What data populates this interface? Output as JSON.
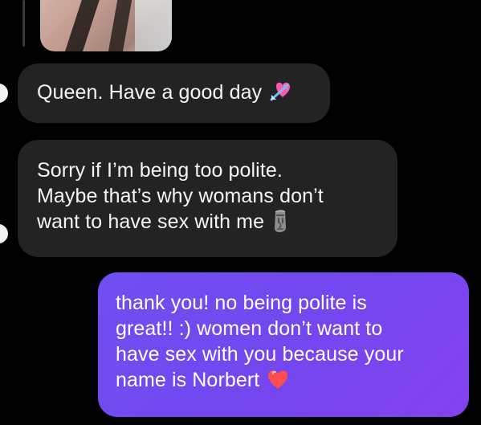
{
  "messages": [
    {
      "side": "incoming",
      "lines": [
        "Queen. Have a good day"
      ],
      "emoji": "heart-with-arrow"
    },
    {
      "side": "incoming",
      "lines": [
        "Sorry if I’m being too polite.",
        "Maybe that’s why womans don’t",
        "want to have sex with me"
      ],
      "emoji": "moai"
    },
    {
      "side": "outgoing",
      "lines": [
        "thank you! no being polite is",
        "great!! :) women don’t want to",
        "have sex with you because your",
        "name is Norbert"
      ],
      "emoji": "red-heart"
    }
  ],
  "colors": {
    "background": "#000000",
    "incoming_bubble": "#232323",
    "outgoing_bubble": "#7347ef",
    "text": "#ffffff"
  }
}
